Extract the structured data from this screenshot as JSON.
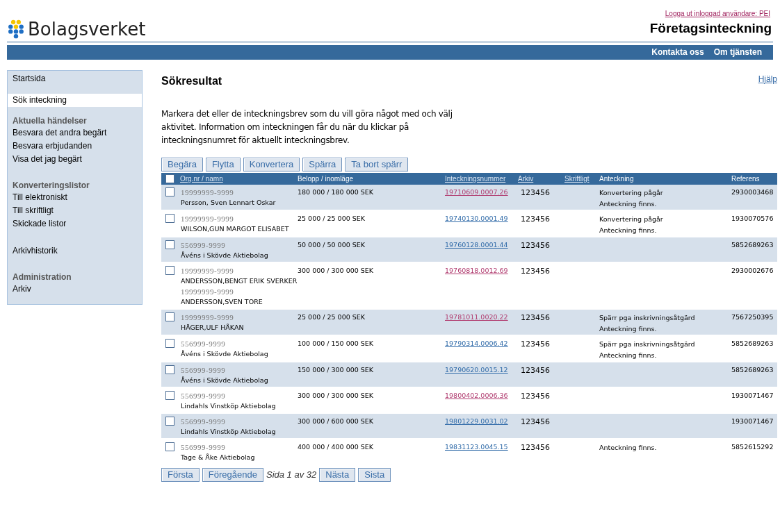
{
  "header": {
    "logout_link": "Logga ut inloggad användare: PEI",
    "logo_text": "Bolagsverket",
    "service_title": "Företagsinteckning",
    "nav_links": [
      "Kontakta oss",
      "Om tjänsten"
    ]
  },
  "sidebar": {
    "sections": [
      {
        "items": [
          {
            "label": "Startsida",
            "selected": false
          }
        ]
      },
      {
        "items": [
          {
            "label": "Sök inteckning",
            "selected": true
          }
        ]
      },
      {
        "heading": "Aktuella händelser",
        "items": [
          {
            "label": "Besvara det andra begärt",
            "selected": false
          },
          {
            "label": "Besvara erbjudanden",
            "selected": false
          },
          {
            "label": "Visa det jag begärt",
            "selected": false
          }
        ]
      },
      {
        "heading": "Konverteringslistor",
        "items": [
          {
            "label": "Till elektroniskt",
            "selected": false
          },
          {
            "label": "Till skriftligt",
            "selected": false
          },
          {
            "label": "Skickade listor",
            "selected": false
          }
        ]
      },
      {
        "items": [
          {
            "label": "Arkivhistorik",
            "selected": false
          }
        ]
      },
      {
        "heading": "Administration",
        "items": [
          {
            "label": "Arkiv",
            "selected": false
          }
        ]
      }
    ]
  },
  "page": {
    "title": "Sökresultat",
    "help_link": "Hjälp",
    "intro": "Markera det eller de inteckningsbrev som du vill göra något med och välj aktivitet. Information om inteckningen får du när du klickar på inteckningsnumret för aktuellt inteckningsbrev."
  },
  "actions": [
    "Begära",
    "Flytta",
    "Konvertera",
    "Spärra",
    "Ta bort spärr"
  ],
  "table": {
    "select_all_checked": false,
    "columns": [
      {
        "label": "Org.nr / namn",
        "sortable": true
      },
      {
        "label": "Belopp / inomläge",
        "sortable": false
      },
      {
        "label": "Inteckningsnummer",
        "sortable": true
      },
      {
        "label": "Arkiv",
        "sortable": true
      },
      {
        "label": "Skriftligt",
        "sortable": true
      },
      {
        "label": "Anteckning",
        "sortable": false
      },
      {
        "label": "Referens",
        "sortable": false
      }
    ],
    "rows": [
      {
        "checked": false,
        "parties": [
          {
            "orgnr": "19999999-9999",
            "name": "Persson, Sven Lennart Oskar"
          }
        ],
        "amount": "180 000 / 180 000 SEK",
        "number": "19710609.0007.26",
        "visited": true,
        "archive": "123456",
        "notes": [
          "Konvertering pågår",
          "Anteckning finns."
        ],
        "reference": "2930003468"
      },
      {
        "checked": false,
        "parties": [
          {
            "orgnr": "19999999-9999",
            "name": "WILSON,GUN MARGOT ELISABET"
          }
        ],
        "amount": "25 000 / 25 000 SEK",
        "number": "19740130.0001.49",
        "visited": false,
        "archive": "123456",
        "notes": [
          "Konvertering pågår",
          "Anteckning finns."
        ],
        "reference": "1930070576"
      },
      {
        "checked": false,
        "parties": [
          {
            "orgnr": "556999-9999",
            "name": "Åvéns i Skövde Aktiebolag"
          }
        ],
        "amount": "50 000 / 50 000 SEK",
        "number": "19760128.0001.44",
        "visited": false,
        "archive": "123456",
        "notes": [],
        "reference": "5852689263"
      },
      {
        "checked": false,
        "parties": [
          {
            "orgnr": "19999999-9999",
            "name": "ANDERSSON,BENGT ERIK SVERKER"
          },
          {
            "orgnr": "19999999-9999",
            "name": "ANDERSSON,SVEN TORE"
          }
        ],
        "amount": "300 000 / 300 000 SEK",
        "number": "19760818.0012.69",
        "visited": true,
        "archive": "123456",
        "notes": [],
        "reference": "2930002676"
      },
      {
        "checked": false,
        "parties": [
          {
            "orgnr": "19999999-9999",
            "name": "HÄGER,ULF HÅKAN"
          }
        ],
        "amount": "25 000 / 25 000 SEK",
        "number": "19781011.0020.22",
        "visited": true,
        "archive": "123456",
        "notes": [
          "Spärr pga inskrivningsåtgärd",
          "Anteckning finns."
        ],
        "reference": "7567250395"
      },
      {
        "checked": false,
        "parties": [
          {
            "orgnr": "556999-9999",
            "name": "Åvéns i Skövde Aktiebolag"
          }
        ],
        "amount": "100 000 / 150 000 SEK",
        "number": "19790314.0006.42",
        "visited": false,
        "archive": "123456",
        "notes": [
          "Spärr pga inskrivningsåtgärd",
          "Anteckning finns."
        ],
        "reference": "5852689263"
      },
      {
        "checked": false,
        "parties": [
          {
            "orgnr": "556999-9999",
            "name": "Åvéns i Skövde Aktiebolag"
          }
        ],
        "amount": "150 000 / 300 000 SEK",
        "number": "19790620.0015.12",
        "visited": false,
        "archive": "123456",
        "notes": [],
        "reference": "5852689263"
      },
      {
        "checked": false,
        "parties": [
          {
            "orgnr": "556999-9999",
            "name": "Lindahls Vinstköp Aktiebolag"
          }
        ],
        "amount": "300 000 / 300 000 SEK",
        "number": "19800402.0006.36",
        "visited": true,
        "archive": "123456",
        "notes": [],
        "reference": "1930071467"
      },
      {
        "checked": false,
        "parties": [
          {
            "orgnr": "556999-9999",
            "name": "Lindahls Vinstköp Aktiebolag"
          }
        ],
        "amount": "300 000 / 600 000 SEK",
        "number": "19801229.0031.02",
        "visited": false,
        "archive": "123456",
        "notes": [],
        "reference": "1930071467"
      },
      {
        "checked": false,
        "parties": [
          {
            "orgnr": "556999-9999",
            "name": "Tage & Åke Aktiebolag"
          }
        ],
        "amount": "400 000 / 400 000 SEK",
        "number": "19831123.0045.15",
        "visited": false,
        "archive": "123456",
        "notes": [
          "Anteckning finns."
        ],
        "reference": "5852615292"
      }
    ]
  },
  "pagination": {
    "first": "Första",
    "previous": "Föregående",
    "status": "Sida 1 av 32",
    "next": "Nästa",
    "last": "Sista"
  }
}
